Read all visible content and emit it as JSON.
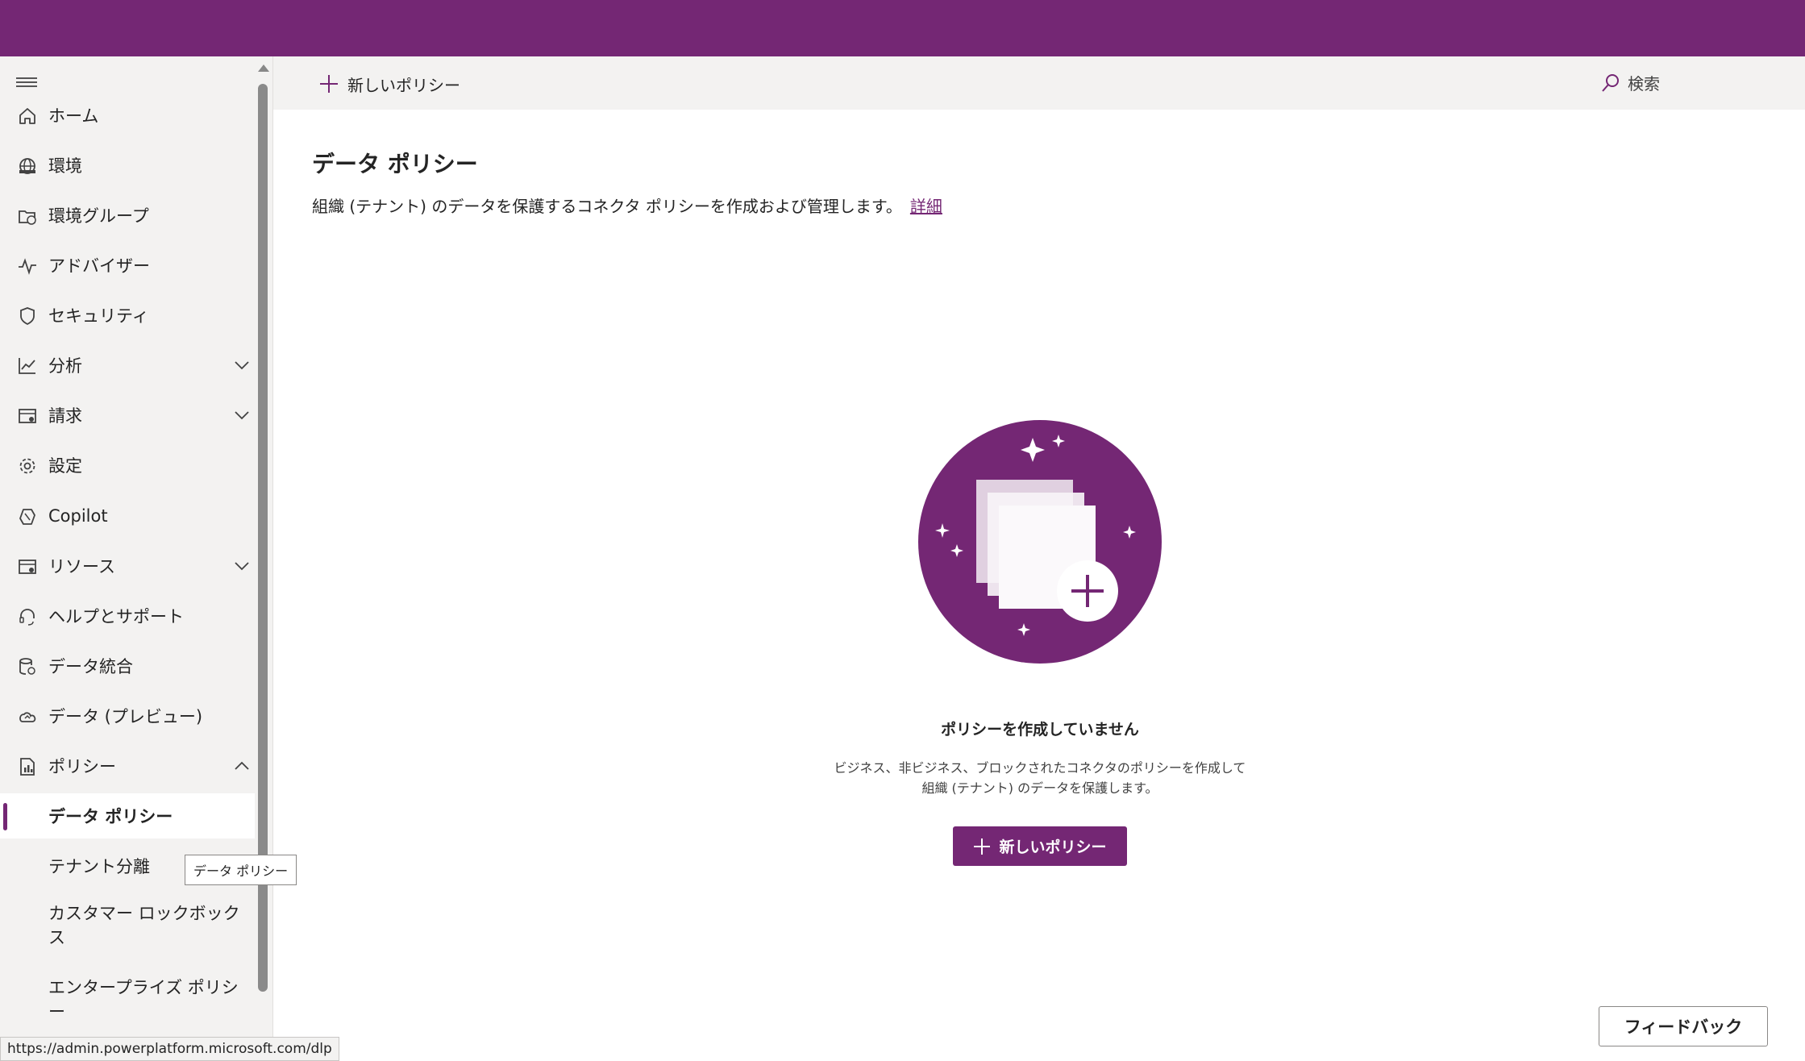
{
  "colors": {
    "brand": "#742774",
    "sidebar_bg": "#f3f2f1"
  },
  "sidebar": {
    "items": [
      {
        "label": "ホーム",
        "icon": "home-icon"
      },
      {
        "label": "環境",
        "icon": "globe-icon"
      },
      {
        "label": "環境グループ",
        "icon": "folder-globe-icon"
      },
      {
        "label": "アドバイザー",
        "icon": "pulse-icon"
      },
      {
        "label": "セキュリティ",
        "icon": "shield-icon"
      },
      {
        "label": "分析",
        "icon": "chart-icon",
        "expandable": true
      },
      {
        "label": "請求",
        "icon": "billing-icon",
        "expandable": true
      },
      {
        "label": "設定",
        "icon": "gear-icon"
      },
      {
        "label": "Copilot",
        "icon": "copilot-icon"
      },
      {
        "label": "リソース",
        "icon": "resources-icon",
        "expandable": true
      },
      {
        "label": "ヘルプとサポート",
        "icon": "headset-icon"
      },
      {
        "label": "データ統合",
        "icon": "database-icon"
      },
      {
        "label": "データ (プレビュー)",
        "icon": "cloud-icon"
      },
      {
        "label": "ポリシー",
        "icon": "policy-icon",
        "expanded": true
      }
    ],
    "subitems": [
      {
        "label": "データ ポリシー",
        "active": true
      },
      {
        "label": "テナント分離"
      },
      {
        "label": "カスタマー ロックボックス"
      },
      {
        "label": "エンタープライズ ポリシー"
      }
    ]
  },
  "cmdbar": {
    "new_policy": "新しいポリシー",
    "search": "検索"
  },
  "main": {
    "title": "データ ポリシー",
    "description": "組織 (テナント) のデータを保護するコネクタ ポリシーを作成および管理します。",
    "learn_more": "詳細"
  },
  "empty_state": {
    "title": "ポリシーを作成していません",
    "desc_line1": "ビジネス、非ビジネス、ブロックされたコネクタのポリシーを作成して",
    "desc_line2": "組織 (テナント) のデータを保護します。",
    "button": "新しいポリシー"
  },
  "tooltip": "データ ポリシー",
  "status_url": "https://admin.powerplatform.microsoft.com/dlp",
  "feedback": "フィードバック"
}
